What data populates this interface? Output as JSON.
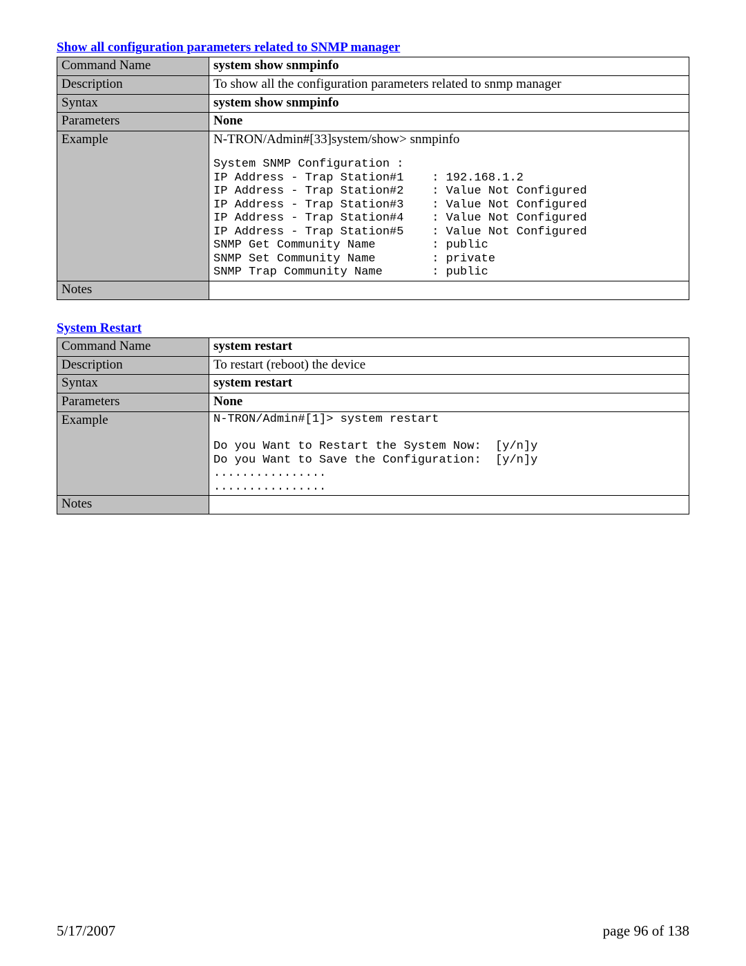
{
  "section1": {
    "title": "Show all configuration parameters related to SNMP manager",
    "rows": {
      "command_name_label": "Command Name",
      "command_name_value": "system show snmpinfo",
      "description_label": "Description",
      "description_value": "To show all the configuration parameters related to snmp manager",
      "syntax_label": "Syntax",
      "syntax_value": "system show snmpinfo",
      "parameters_label": "Parameters",
      "parameters_value": "None",
      "example_label": "Example",
      "example_value_line1": "N-TRON/Admin#[33]system/show> snmpinfo",
      "example_mono": "System SNMP Configuration :\nIP Address - Trap Station#1    : 192.168.1.2\nIP Address - Trap Station#2    : Value Not Configured\nIP Address - Trap Station#3    : Value Not Configured\nIP Address - Trap Station#4    : Value Not Configured\nIP Address - Trap Station#5    : Value Not Configured\nSNMP Get Community Name        : public\nSNMP Set Community Name        : private\nSNMP Trap Community Name       : public",
      "notes_label": "Notes",
      "notes_value": ""
    }
  },
  "section2": {
    "title": "System Restart",
    "rows": {
      "command_name_label": "Command Name",
      "command_name_value": "system  restart",
      "description_label": "Description",
      "description_value": "To restart (reboot) the device",
      "syntax_label": "Syntax",
      "syntax_value": "system restart",
      "parameters_label": "Parameters",
      "parameters_value": "None",
      "example_label": "Example",
      "example_mono": "N-TRON/Admin#[1]> system restart\n\nDo you Want to Restart the System Now:  [y/n]y\nDo you Want to Save the Configuration:  [y/n]y\n................\n................",
      "notes_label": "Notes",
      "notes_value": ""
    }
  },
  "footer": {
    "date": "5/17/2007",
    "page": "page 96 of 138"
  }
}
